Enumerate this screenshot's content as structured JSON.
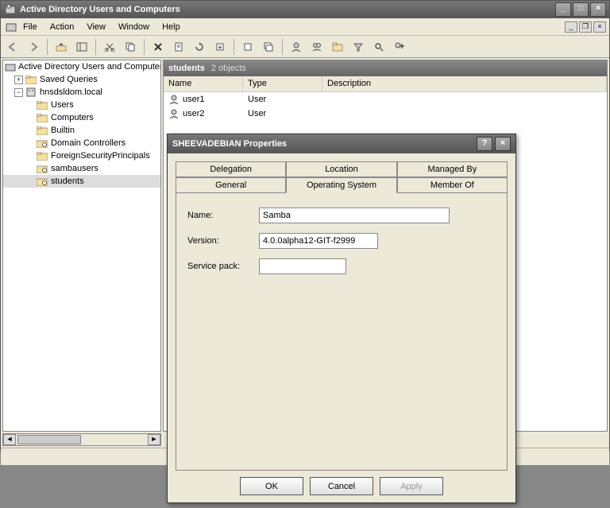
{
  "window": {
    "title": "Active Directory Users and Computers"
  },
  "menu": {
    "file": "File",
    "action": "Action",
    "view": "View",
    "window": "Window",
    "help": "Help"
  },
  "tree": {
    "root": "Active Directory Users and Computers",
    "saved": "Saved Queries",
    "domain": "hnsdsldom.local",
    "users": "Users",
    "computers": "Computers",
    "builtin": "Builtin",
    "dc": "Domain Controllers",
    "fsp": "ForeignSecurityPrincipals",
    "sambausers": "sambausers",
    "students": "students"
  },
  "path": {
    "folder": "students",
    "count": "2 objects"
  },
  "columns": {
    "name": "Name",
    "type": "Type",
    "desc": "Description"
  },
  "rows": [
    {
      "name": "user1",
      "type": "User",
      "desc": ""
    },
    {
      "name": "user2",
      "type": "User",
      "desc": ""
    }
  ],
  "dialog": {
    "title": "SHEEVADEBIAN Properties",
    "tabs": {
      "delegation": "Delegation",
      "location": "Location",
      "managedby": "Managed By",
      "general": "General",
      "os": "Operating System",
      "memberof": "Member Of"
    },
    "labels": {
      "name": "Name:",
      "version": "Version:",
      "sp": "Service pack:"
    },
    "values": {
      "name": "Samba",
      "version": "4.0.0alpha12-GIT-f2999",
      "sp": ""
    },
    "buttons": {
      "ok": "OK",
      "cancel": "Cancel",
      "apply": "Apply"
    }
  }
}
